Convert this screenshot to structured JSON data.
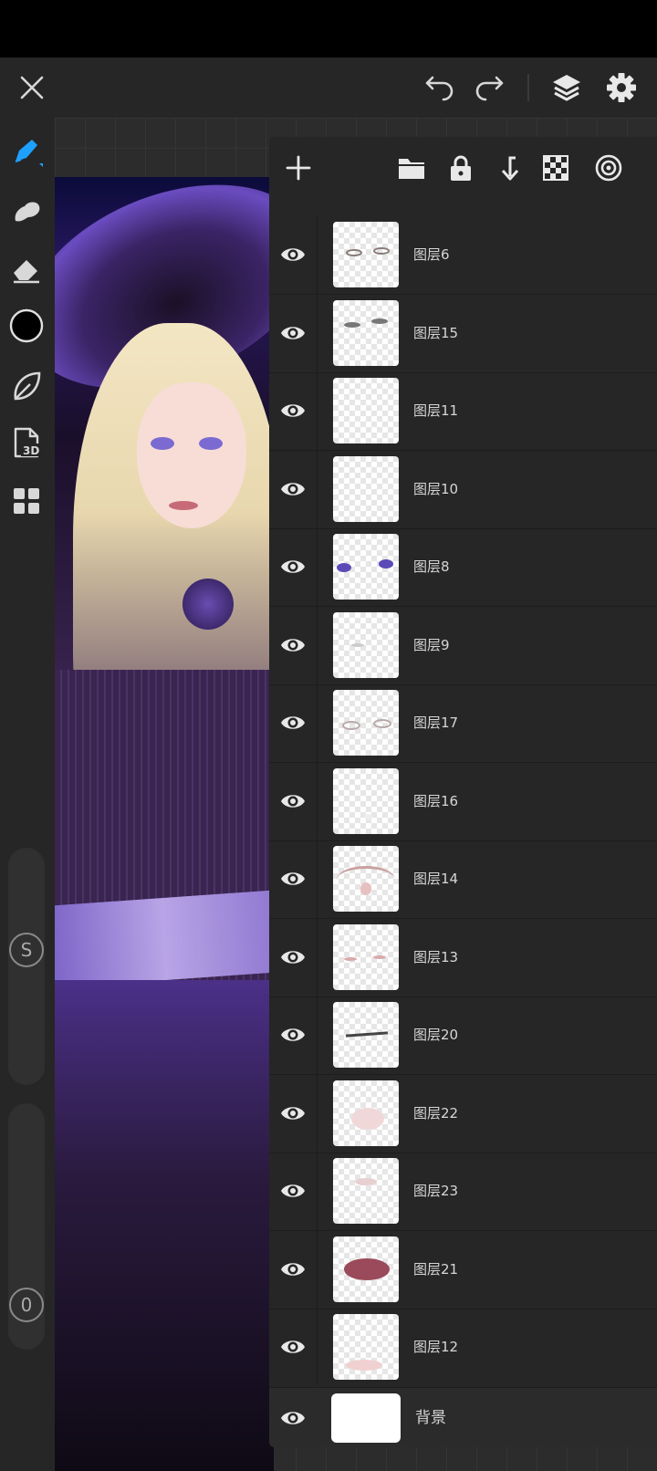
{
  "colors": {
    "accent": "#1ea0ff",
    "toolbar_bg": "#262626",
    "panel_bg": "#262626",
    "icon": "#d8d8d8"
  },
  "top_bar": {
    "close_icon": "close-icon",
    "undo_icon": "undo-icon",
    "redo_icon": "redo-icon",
    "layers_icon": "layers-icon",
    "settings_icon": "gear-icon"
  },
  "tools": [
    {
      "name": "pen",
      "icon": "pen-icon",
      "active": true
    },
    {
      "name": "smudge",
      "icon": "smudge-icon"
    },
    {
      "name": "eraser",
      "icon": "eraser-icon"
    },
    {
      "name": "color",
      "icon": "color-circle-icon"
    },
    {
      "name": "liquify",
      "icon": "leaf-icon"
    },
    {
      "name": "3d",
      "icon": "3d-file-icon",
      "label": "3D"
    },
    {
      "name": "more",
      "icon": "grid-icon"
    }
  ],
  "sliders": {
    "size_label": "S",
    "opacity_label": "0"
  },
  "layers_panel": {
    "header_icons": [
      "add-icon",
      "folder-icon",
      "lock-icon",
      "merge-down-icon",
      "checker-icon",
      "target-icon"
    ],
    "layers": [
      {
        "name": "图层6"
      },
      {
        "name": "图层15"
      },
      {
        "name": "图层11"
      },
      {
        "name": "图层10"
      },
      {
        "name": "图层8"
      },
      {
        "name": "图层9"
      },
      {
        "name": "图层17"
      },
      {
        "name": "图层16"
      },
      {
        "name": "图层14"
      },
      {
        "name": "图层13"
      },
      {
        "name": "图层20"
      },
      {
        "name": "图层22"
      },
      {
        "name": "图层23"
      },
      {
        "name": "图层21"
      },
      {
        "name": "图层12"
      }
    ],
    "background_layer": {
      "name": "背景"
    }
  }
}
